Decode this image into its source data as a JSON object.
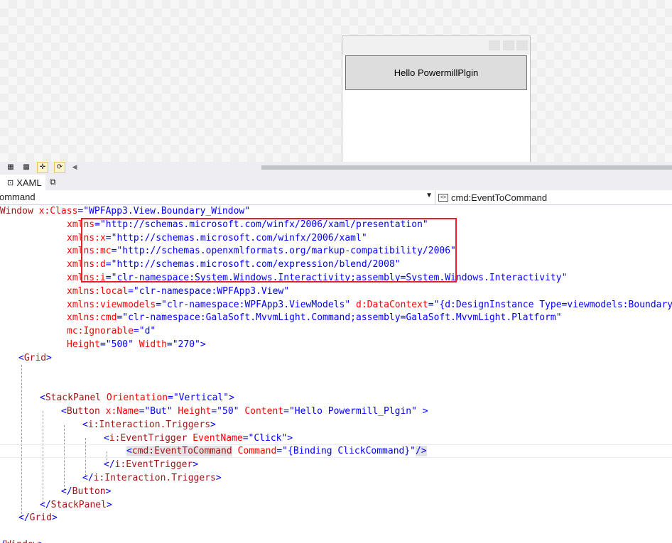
{
  "designer": {
    "preview_button_content": "Hello PowermillPlgin"
  },
  "designer_toolbar": {
    "icons": [
      "grid-icon",
      "pattern-icon",
      "snap-icon",
      "refresh-icon",
      "scroll-left-icon"
    ]
  },
  "editor_tabs": {
    "xaml_tab_label": "XAML",
    "extra_icon": "popout-icon"
  },
  "nav_bar": {
    "left_value": "ommand",
    "right_value": "cmd:EventToCommand"
  },
  "code": {
    "lines": [
      {
        "t": [
          [
            "b",
            "<"
          ],
          [
            "e",
            "Window"
          ],
          [
            "a",
            " x:Class"
          ],
          [
            "b",
            "=\"WPFApp3.View.Boundary_Window\""
          ]
        ]
      },
      {
        "t": [
          [
            "a",
            "xmlns"
          ],
          [
            "b",
            "=\"http://schemas.microsoft.com/winfx/2006/xaml/presentation\""
          ]
        ]
      },
      {
        "t": [
          [
            "a",
            "xmlns:x"
          ],
          [
            "b",
            "=\"http://schemas.microsoft.com/winfx/2006/xaml\""
          ]
        ]
      },
      {
        "t": [
          [
            "a",
            "xmlns:mc"
          ],
          [
            "b",
            "=\"http://schemas.openxmlformats.org/markup-compatibility/2006\""
          ]
        ]
      },
      {
        "t": [
          [
            "a",
            "xmlns:d"
          ],
          [
            "b",
            "=\"http://schemas.microsoft.com/expression/blend/2008\""
          ]
        ]
      },
      {
        "t": [
          [
            "a",
            "xmlns:i"
          ],
          [
            "b",
            "=\"clr-namespace:System.Windows.Interactivity;assembly=System.Windows.Interactivity\""
          ]
        ]
      },
      {
        "t": [
          [
            "a",
            "xmlns:local"
          ],
          [
            "b",
            "=\"clr-namespace:WPFApp3.View\""
          ]
        ]
      },
      {
        "t": [
          [
            "a",
            "xmlns:viewmodels"
          ],
          [
            "b",
            "=\"clr-namespace:WPFApp3.ViewModels\""
          ],
          [
            "a",
            " d:DataContext"
          ],
          [
            "b",
            "=\"{d:DesignInstance Type=viewmodels:Boundary_Vi"
          ]
        ]
      },
      {
        "t": [
          [
            "a",
            "xmlns:cmd"
          ],
          [
            "b",
            "=\"clr-namespace:GalaSoft.MvvmLight.Command;assembly=GalaSoft.MvvmLight.Platform\""
          ]
        ]
      },
      {
        "t": [
          [
            "a",
            "mc:Ignorable"
          ],
          [
            "b",
            "=\"d\""
          ]
        ]
      },
      {
        "t": [
          [
            "a",
            "Height"
          ],
          [
            "b",
            "=\"500\""
          ],
          [
            "a",
            " Width"
          ],
          [
            "b",
            "=\"270\">"
          ]
        ]
      },
      {
        "t": [
          [
            "b",
            "<"
          ],
          [
            "e",
            "Grid"
          ],
          [
            "b",
            ">"
          ]
        ]
      },
      {
        "t": []
      },
      {
        "t": []
      },
      {
        "t": [
          [
            "b",
            "<"
          ],
          [
            "e",
            "StackPanel"
          ],
          [
            "a",
            " Orientation"
          ],
          [
            "b",
            "=\"Vertical\">"
          ]
        ]
      },
      {
        "t": [
          [
            "b",
            "<"
          ],
          [
            "e",
            "Button"
          ],
          [
            "a",
            " x:Name"
          ],
          [
            "b",
            "=\"But\""
          ],
          [
            "a",
            " Height"
          ],
          [
            "b",
            "=\"50\""
          ],
          [
            "a",
            " Content"
          ],
          [
            "b",
            "=\"Hello Powermill_Plgin\""
          ],
          [
            "b",
            " >"
          ]
        ]
      },
      {
        "t": [
          [
            "b",
            "<"
          ],
          [
            "e",
            "i:Interaction.Triggers"
          ],
          [
            "b",
            ">"
          ]
        ]
      },
      {
        "t": [
          [
            "b",
            "<"
          ],
          [
            "e",
            "i:EventTrigger"
          ],
          [
            "a",
            " EventName"
          ],
          [
            "b",
            "=\"Click\">"
          ]
        ]
      },
      {
        "t": [
          [
            "hb",
            "<"
          ],
          [
            "he",
            "cmd:EventToCommand"
          ],
          [
            "a",
            " Command"
          ],
          [
            "b",
            "=\"{Binding ClickCommand}\""
          ],
          [
            "hb",
            "/>"
          ]
        ]
      },
      {
        "t": [
          [
            "b",
            "</"
          ],
          [
            "e",
            "i:EventTrigger"
          ],
          [
            "b",
            ">"
          ]
        ]
      },
      {
        "t": [
          [
            "b",
            "</"
          ],
          [
            "e",
            "i:Interaction.Triggers"
          ],
          [
            "b",
            ">"
          ]
        ]
      },
      {
        "t": [
          [
            "b",
            "</"
          ],
          [
            "e",
            "Button"
          ],
          [
            "b",
            ">"
          ]
        ]
      },
      {
        "t": [
          [
            "b",
            "</"
          ],
          [
            "e",
            "StackPanel"
          ],
          [
            "b",
            ">"
          ]
        ]
      },
      {
        "t": [
          [
            "b",
            "</"
          ],
          [
            "e",
            "Grid"
          ],
          [
            "b",
            ">"
          ]
        ]
      },
      {
        "t": []
      },
      {
        "t": [
          [
            "b",
            "</"
          ],
          [
            "e",
            "Window"
          ],
          [
            "b",
            ">"
          ]
        ]
      }
    ]
  },
  "annotation": {
    "highlight_color": "#e8202a"
  }
}
